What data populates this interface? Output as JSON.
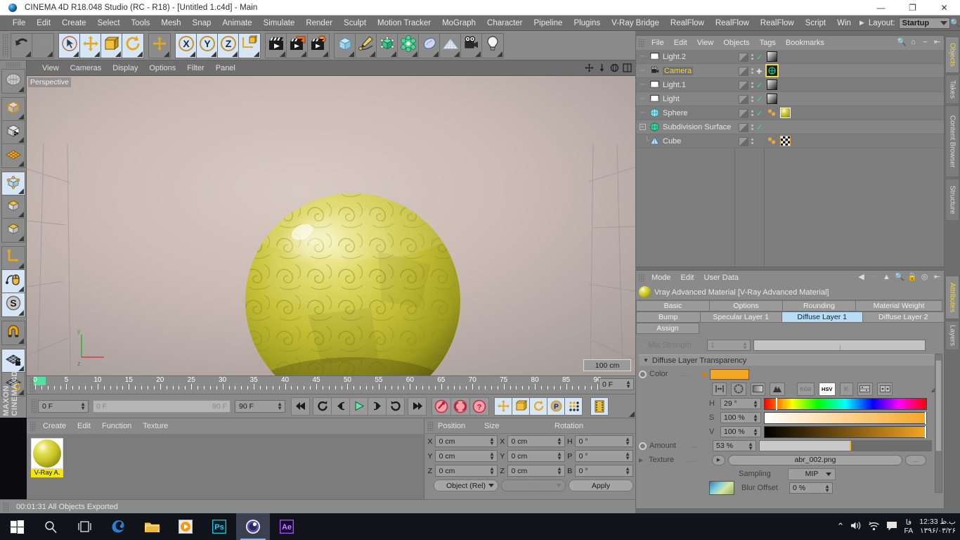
{
  "titlebar": {
    "title": "CINEMA 4D R18.048 Studio (RC - R18) - [Untitled 1.c4d] - Main",
    "minimize": "—",
    "maximize": "❐",
    "close": "✕"
  },
  "menubar": {
    "items": [
      "File",
      "Edit",
      "Create",
      "Select",
      "Tools",
      "Mesh",
      "Snap",
      "Animate",
      "Simulate",
      "Render",
      "Sculpt",
      "Motion Tracker",
      "MoGraph",
      "Character",
      "Pipeline",
      "Plugins",
      "V-Ray Bridge",
      "RealFlow",
      "RealFlow",
      "RealFlow",
      "Script",
      "Win"
    ],
    "arrow": "▶",
    "layout_label": "Layout:",
    "layout_value": "Startup",
    "search_icon": "search-icon"
  },
  "toolbar": {
    "groups": [
      {
        "name": "undo-redo",
        "buttons": [
          {
            "name": "undo-button",
            "icon": "undo",
            "lit": false
          },
          {
            "name": "redo-button",
            "icon": "redo",
            "lit": false
          }
        ]
      },
      {
        "name": "transform-tools",
        "buttons": [
          {
            "name": "live-selection-tool",
            "icon": "cursor-circle",
            "lit": true
          },
          {
            "name": "move-tool",
            "icon": "move-arrows",
            "lit": true
          },
          {
            "name": "scale-tool",
            "icon": "scale-box",
            "lit": true
          },
          {
            "name": "rotate-tool",
            "icon": "rotate-arc",
            "lit": true
          }
        ]
      },
      {
        "name": "world-axis-group",
        "buttons": [
          {
            "name": "world-axis-tool",
            "icon": "plus-axis",
            "lit": false
          }
        ]
      },
      {
        "name": "axis-locks",
        "buttons": [
          {
            "name": "lock-x-axis",
            "icon": "x-circle",
            "lit": true
          },
          {
            "name": "lock-y-axis",
            "icon": "y-circle",
            "lit": true
          },
          {
            "name": "lock-z-axis",
            "icon": "z-circle",
            "lit": true
          },
          {
            "name": "world-object-coordinates",
            "icon": "axis-cube",
            "lit": true
          }
        ]
      },
      {
        "name": "render-group",
        "buttons": [
          {
            "name": "render-view-button",
            "icon": "clapper",
            "lit": false
          },
          {
            "name": "render-region-button",
            "icon": "clapper-picture",
            "lit": false
          },
          {
            "name": "render-settings-button",
            "icon": "clapper-gear",
            "lit": false
          }
        ]
      },
      {
        "name": "object-creation",
        "buttons": [
          {
            "name": "add-cube-button",
            "icon": "cube",
            "lit": false
          },
          {
            "name": "add-spline-button",
            "icon": "pen-spline",
            "lit": false
          },
          {
            "name": "add-generator-button",
            "icon": "green-cube",
            "lit": false
          },
          {
            "name": "add-deformer-button",
            "icon": "green-sphere",
            "lit": false
          },
          {
            "name": "add-scene-object-button",
            "icon": "blue-blob",
            "lit": false
          },
          {
            "name": "add-environment-button",
            "icon": "floor-grid",
            "lit": false
          },
          {
            "name": "add-camera-button",
            "icon": "camera",
            "lit": false
          },
          {
            "name": "add-light-button",
            "icon": "light-bulb",
            "lit": false
          }
        ]
      }
    ]
  },
  "lefttoolbar": {
    "groups": [
      [
        {
          "name": "make-editable-tool",
          "icon": "editable-mesh",
          "lit": false
        }
      ],
      [
        {
          "name": "model-mode",
          "icon": "orange-cube",
          "lit": false
        },
        {
          "name": "texture-mode",
          "icon": "checker-cube",
          "lit": false
        },
        {
          "name": "texture-axis-mode",
          "icon": "orange-grid",
          "lit": false
        }
      ],
      [
        {
          "name": "points-mode",
          "icon": "points-cube",
          "lit": true
        },
        {
          "name": "edges-mode",
          "icon": "edges-cube",
          "lit": false
        },
        {
          "name": "polygons-mode",
          "icon": "polygons-cube",
          "lit": false
        }
      ],
      [
        {
          "name": "enable-axis-modification",
          "icon": "axis-L",
          "lit": false
        },
        {
          "name": "enable-snap",
          "icon": "mouse-spline",
          "lit": true
        },
        {
          "name": "soft-selection",
          "icon": "s-circle",
          "lit": true
        }
      ],
      [
        {
          "name": "snap-settings",
          "icon": "magnet",
          "lit": false
        }
      ],
      [
        {
          "name": "workplane-lock",
          "icon": "grid-lock",
          "lit": true
        },
        {
          "name": "workplane-rotate",
          "icon": "grid-rotate",
          "lit": false
        }
      ]
    ],
    "brand_line1": "MAXON",
    "brand_line2": "CINEMA 4D"
  },
  "viewport": {
    "menu": [
      "View",
      "Cameras",
      "Display",
      "Options",
      "Filter",
      "Panel"
    ],
    "corner_icons": [
      "pan-icon",
      "dolly-icon",
      "orbit-icon",
      "maximize-view-icon"
    ],
    "label": "Perspective",
    "scale": "100 cm"
  },
  "timeline": {
    "ticks": [
      0,
      5,
      10,
      15,
      20,
      25,
      30,
      35,
      40,
      45,
      50,
      55,
      60,
      65,
      70,
      75,
      80,
      85,
      90
    ],
    "current_frame_top": "0 F",
    "start_frame": "0 F",
    "preview_start": "0 F",
    "preview_end": "90 F",
    "end_frame": "90 F",
    "transport": [
      {
        "name": "go-to-start-button",
        "icon": "⏮"
      },
      {
        "name": "play-reverse-loop-button",
        "icon": "loop"
      },
      {
        "name": "go-to-previous-key-button",
        "icon": "prev-key"
      },
      {
        "name": "play-button",
        "icon": "play"
      },
      {
        "name": "go-to-next-key-button",
        "icon": "next-key"
      },
      {
        "name": "loop-playback-button",
        "icon": "loop-fwd"
      },
      {
        "name": "go-to-end-button",
        "icon": "⏭"
      }
    ],
    "record_buttons": [
      {
        "name": "record-active-objects-button",
        "icon": "key-red"
      },
      {
        "name": "autokeying-button",
        "icon": "parens-red"
      },
      {
        "name": "keyframe-selection-button",
        "icon": "question-red"
      }
    ],
    "key_filter_buttons": [
      {
        "name": "position-keys-button",
        "icon": "move-arrows"
      },
      {
        "name": "scale-keys-button",
        "icon": "scale-box"
      },
      {
        "name": "rotation-keys-button",
        "icon": "rotate-arc"
      },
      {
        "name": "parameter-keys-button",
        "icon": "p-circle"
      },
      {
        "name": "point-level-animation-button",
        "icon": "pla-dots"
      }
    ],
    "extra_button": {
      "name": "timeline-window-button",
      "icon": "filmstrip"
    }
  },
  "material_manager": {
    "menu": [
      "Create",
      "Edit",
      "Function",
      "Texture"
    ],
    "materials": [
      {
        "name": "V-Ray A."
      }
    ]
  },
  "coordinates": {
    "headers": [
      "Position",
      "Size",
      "Rotation"
    ],
    "rows": [
      {
        "pos_axis": "X",
        "pos_value": "0 cm",
        "size_axis": "X",
        "size_value": "0 cm",
        "rot_axis": "H",
        "rot_value": "0 °"
      },
      {
        "pos_axis": "Y",
        "pos_value": "0 cm",
        "size_axis": "Y",
        "size_value": "0 cm",
        "rot_axis": "P",
        "rot_value": "0 °"
      },
      {
        "pos_axis": "Z",
        "pos_value": "0 cm",
        "size_axis": "Z",
        "size_value": "0 cm",
        "rot_axis": "B",
        "rot_value": "0 °"
      }
    ],
    "mode_dropdown": "Object (Rel)",
    "size_dropdown": "Size",
    "apply_button": "Apply"
  },
  "statusbar": {
    "text": "00:01:31 All Objects Exported"
  },
  "object_manager": {
    "menu": [
      "File",
      "Edit",
      "View",
      "Objects",
      "Tags",
      "Bookmarks"
    ],
    "tools": [
      "search-icon",
      "home-icon",
      "minus-icon",
      "fit-icon"
    ],
    "rows": [
      {
        "name": "Light.2",
        "icon": "light-icon",
        "selected": false,
        "indent": 0,
        "expander": "",
        "visdot": "check",
        "tags": [
          "light-tag"
        ]
      },
      {
        "name": "Camera",
        "icon": "camera-icon",
        "selected": true,
        "indent": 0,
        "expander": "",
        "visdot": "cross",
        "tags": [
          "camera-tag"
        ]
      },
      {
        "name": "Light.1",
        "icon": "light-icon",
        "selected": false,
        "indent": 0,
        "expander": "",
        "visdot": "check",
        "tags": [
          "light-tag"
        ]
      },
      {
        "name": "Light",
        "icon": "light-icon",
        "selected": false,
        "indent": 0,
        "expander": "",
        "visdot": "check",
        "tags": [
          "light-tag"
        ]
      },
      {
        "name": "Sphere",
        "icon": "sphere-icon",
        "selected": false,
        "indent": 0,
        "expander": "",
        "visdot": "check",
        "tags": [
          "material-tag",
          "texture-yellow"
        ]
      },
      {
        "name": "Subdivision Surface",
        "icon": "subdivision-icon",
        "selected": false,
        "indent": 0,
        "expander": "minus",
        "visdot": "check",
        "tags": []
      },
      {
        "name": "Cube",
        "icon": "cube-icon",
        "selected": false,
        "indent": 1,
        "expander": "",
        "visdot": "none",
        "tags": [
          "material-tag",
          "texture-checker"
        ]
      }
    ]
  },
  "attribute_manager": {
    "menu": [
      "Mode",
      "Edit",
      "User Data"
    ],
    "tools": [
      "back-arrow-icon",
      "forward-arrow-icon",
      "up-arrow-icon",
      "search-icon",
      "lock-icon",
      "target-icon",
      "pin-icon"
    ],
    "object_title": "Vray Advanced Material [V-Ray Advanced Material]",
    "tabs_row1": [
      {
        "label": "Basic",
        "active": false
      },
      {
        "label": "Options",
        "active": false
      },
      {
        "label": "Rounding",
        "active": false
      },
      {
        "label": "Material Weight",
        "active": false
      }
    ],
    "tabs_row2": [
      {
        "label": "Bump",
        "active": false
      },
      {
        "label": "Specular Layer 1",
        "active": false
      },
      {
        "label": "Diffuse Layer 1",
        "active": true
      },
      {
        "label": "Diffuse Layer 2",
        "active": false
      }
    ],
    "tabs_row3": [
      {
        "label": "Assign",
        "active": false
      }
    ],
    "mix_strength": {
      "label": "Mix Strength",
      "value": "1"
    },
    "group_title": "Diffuse Layer Transparency",
    "color_label": "Color",
    "color_dots": "....",
    "color_value": "#F5A623",
    "color_mode_buttons": [
      {
        "name": "color-range-button",
        "icon": "range",
        "on": false
      },
      {
        "name": "color-wheel-button",
        "icon": "wheel",
        "on": false
      },
      {
        "name": "color-gradient-button",
        "icon": "gradient",
        "on": false
      },
      {
        "name": "color-mixer-button",
        "icon": "mixer",
        "on": false
      }
    ],
    "color_space_buttons": [
      {
        "name": "rgb-mode-button",
        "label": "RGB",
        "on": false
      },
      {
        "name": "hsv-mode-button",
        "label": "HSV",
        "on": true
      },
      {
        "name": "kelvin-mode-button",
        "label": "K",
        "on": false
      },
      {
        "name": "color-swatch-button",
        "icon": "swatch",
        "on": false
      },
      {
        "name": "color-preset-button",
        "icon": "preset",
        "on": false
      }
    ],
    "eyedropper": "eyedropper-icon",
    "hsv": [
      {
        "label": "H",
        "value": "29 °",
        "pct": 8
      },
      {
        "label": "S",
        "value": "100 %",
        "pct": 100
      },
      {
        "label": "V",
        "value": "100 %",
        "pct": 100
      }
    ],
    "amount": {
      "label": "Amount",
      "dots": "....",
      "value": "53 %",
      "pct": 53
    },
    "texture": {
      "label": "Texture",
      "dots": ".....",
      "value": "abr_002.png",
      "browse": "..."
    },
    "sampling": {
      "label": "Sampling",
      "value": "MIP"
    },
    "blur_offset": {
      "label": "Blur Offset",
      "value": "0 %"
    }
  },
  "vertical_tabs_top": [
    {
      "label": "Objects",
      "active": true
    },
    {
      "label": "Takes",
      "active": false
    },
    {
      "label": "Content Browser",
      "active": false
    },
    {
      "label": "Structure",
      "active": false
    }
  ],
  "vertical_tabs_bottom": [
    {
      "label": "Attributes",
      "active": true
    },
    {
      "label": "Layers",
      "active": false
    }
  ],
  "taskbar": {
    "items": [
      {
        "name": "start-button",
        "icon": "windows-logo",
        "active": false
      },
      {
        "name": "search-taskbar-button",
        "icon": "search-icon",
        "active": false
      },
      {
        "name": "task-view-button",
        "icon": "task-view-icon",
        "active": false
      },
      {
        "name": "edge-browser-button",
        "icon": "edge-icon",
        "active": false
      },
      {
        "name": "file-explorer-button",
        "icon": "folder-icon",
        "active": false
      },
      {
        "name": "media-player-button",
        "icon": "media-icon",
        "active": false
      },
      {
        "name": "photoshop-button",
        "icon": "photoshop-icon",
        "active": false
      },
      {
        "name": "cinema4d-button",
        "icon": "cinema4d-icon",
        "active": true
      },
      {
        "name": "after-effects-button",
        "icon": "after-effects-icon",
        "active": false
      }
    ],
    "tray": {
      "chevron": "⌃",
      "volume": "volume-icon",
      "network": "network-icon",
      "action_center": "notification-icon",
      "lang_line1": "فا",
      "lang_line2": "FA",
      "clock_time": "12:33 ب.ظ",
      "clock_date": "۱۳۹۶/۰۳/۲۶"
    }
  }
}
